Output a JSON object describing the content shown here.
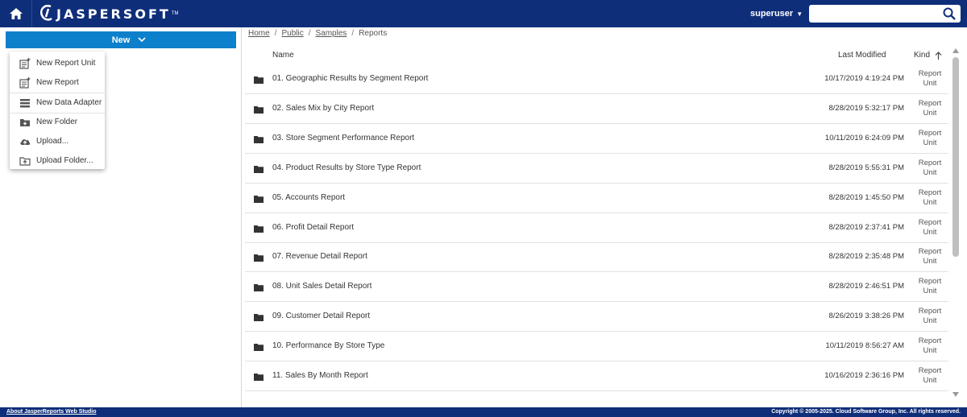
{
  "header": {
    "home_icon": "home-icon",
    "logo_text": "JASPERSOFT",
    "logo_tm": "TM",
    "user": "superuser",
    "search_value": "",
    "search_icon": "search-icon",
    "bar_color": "#0f2e7a"
  },
  "sidebar": {
    "new_label": "New",
    "accent_color": "#0d80cc",
    "menu": [
      {
        "label": "New Report Unit",
        "icon": "new-report-unit-icon"
      },
      {
        "label": "New Report",
        "icon": "new-report-icon"
      },
      {
        "label": "New Data Adapter",
        "icon": "data-adapter-icon"
      },
      {
        "label": "New Folder",
        "icon": "new-folder-icon"
      },
      {
        "label": "Upload...",
        "icon": "upload-cloud-icon"
      },
      {
        "label": "Upload Folder...",
        "icon": "upload-folder-icon"
      }
    ]
  },
  "breadcrumb": {
    "items": [
      "Home",
      "Public",
      "Samples"
    ],
    "current": "Reports"
  },
  "table": {
    "headers": {
      "name": "Name",
      "modified": "Last Modified",
      "kind": "Kind"
    },
    "rows": [
      {
        "name": "01. Geographic Results by Segment Report",
        "modified": "10/17/2019 4:19:24 PM",
        "kind": "Report Unit"
      },
      {
        "name": "02. Sales Mix by City Report",
        "modified": "8/28/2019 5:32:17 PM",
        "kind": "Report Unit"
      },
      {
        "name": "03. Store Segment Performance Report",
        "modified": "10/11/2019 6:24:09 PM",
        "kind": "Report Unit"
      },
      {
        "name": "04. Product Results by Store Type Report",
        "modified": "8/28/2019 5:55:31 PM",
        "kind": "Report Unit"
      },
      {
        "name": "05. Accounts Report",
        "modified": "8/28/2019 1:45:50 PM",
        "kind": "Report Unit"
      },
      {
        "name": "06. Profit Detail Report",
        "modified": "8/28/2019 2:37:41 PM",
        "kind": "Report Unit"
      },
      {
        "name": "07. Revenue Detail Report",
        "modified": "8/28/2019 2:35:48 PM",
        "kind": "Report Unit"
      },
      {
        "name": "08. Unit Sales Detail Report",
        "modified": "8/28/2019 2:46:51 PM",
        "kind": "Report Unit"
      },
      {
        "name": "09. Customer Detail Report",
        "modified": "8/26/2019 3:38:26 PM",
        "kind": "Report Unit"
      },
      {
        "name": "10. Performance By Store Type",
        "modified": "10/11/2019 8:56:27 AM",
        "kind": "Report Unit"
      },
      {
        "name": "11. Sales By Month Report",
        "modified": "10/16/2019 2:36:16 PM",
        "kind": "Report Unit"
      }
    ]
  },
  "footer": {
    "about": "About JasperReports Web Studio",
    "copyright": "Copyright © 2005-2025. Cloud Software Group, Inc. All rights reserved."
  }
}
